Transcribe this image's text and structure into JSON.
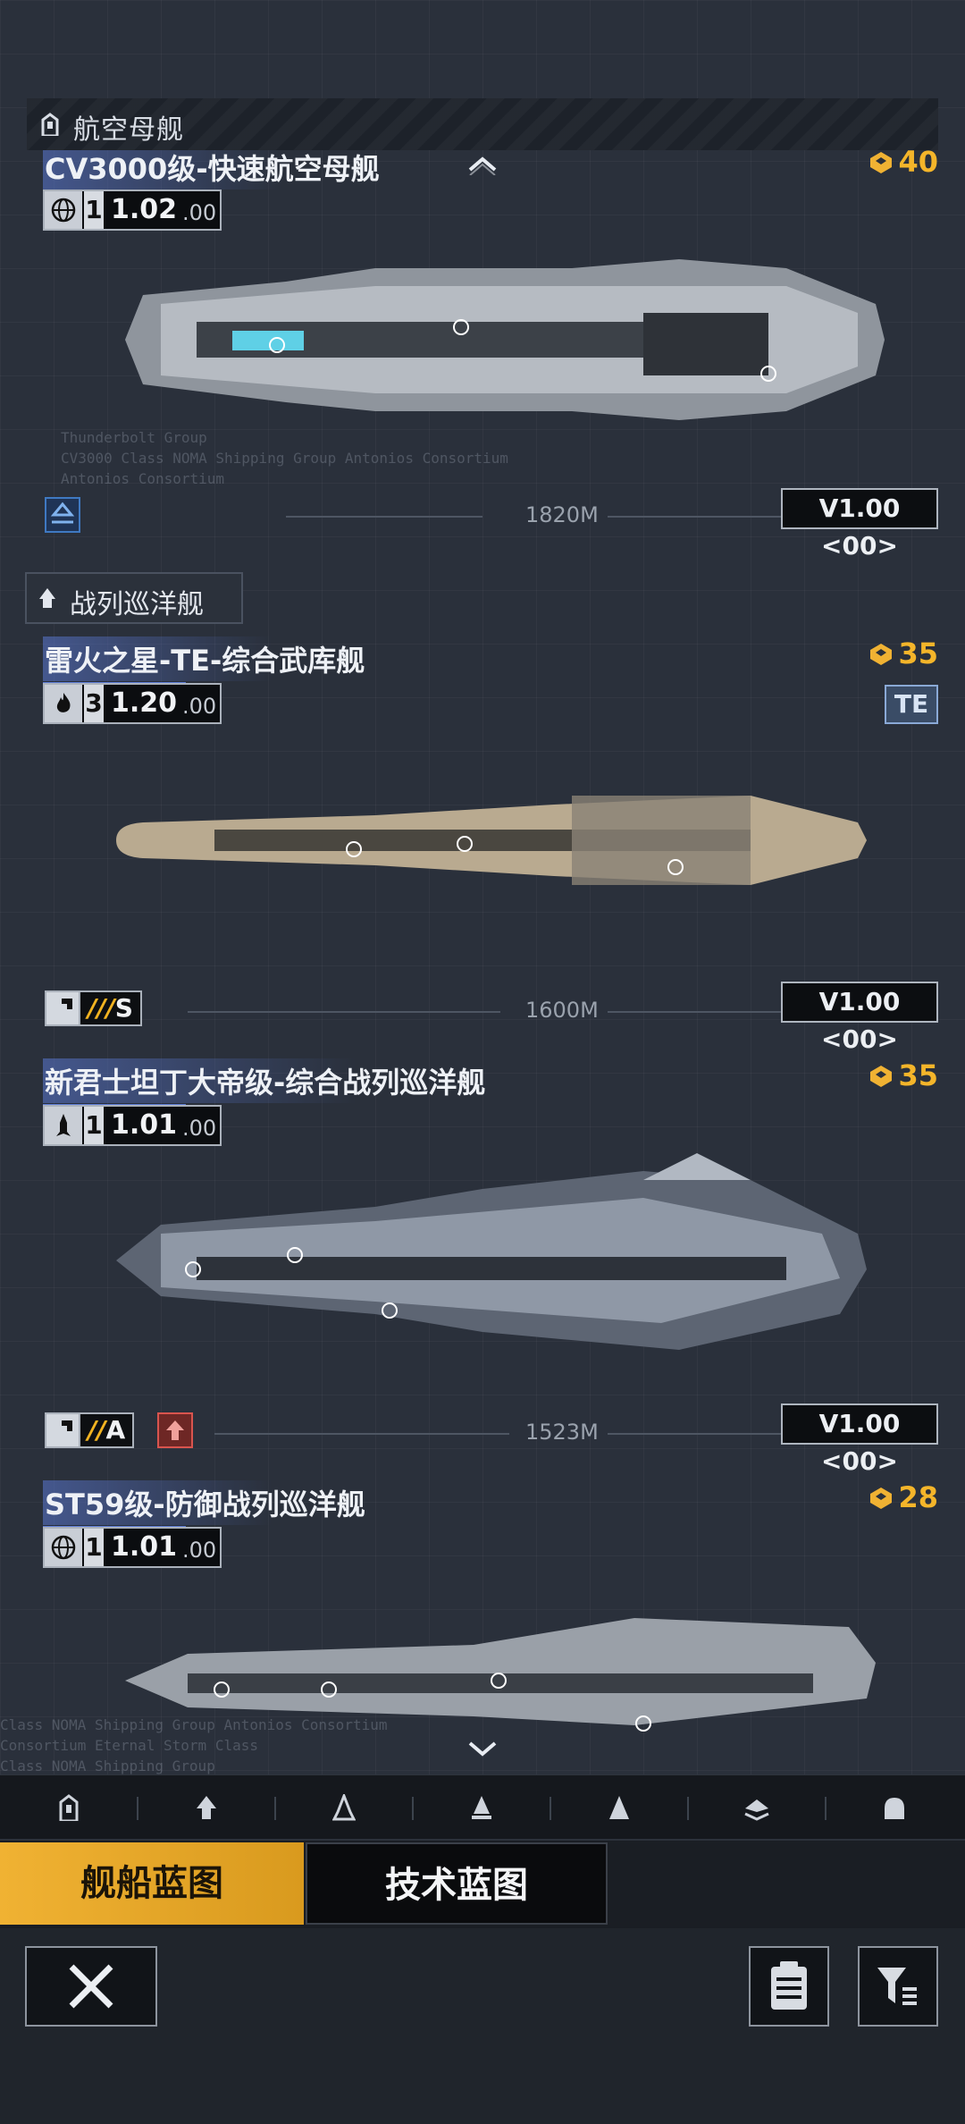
{
  "sections": {
    "carrier_header": "航空母舰",
    "battlecruiser_header": "战列巡洋舰"
  },
  "ships": [
    {
      "name": "CV3000级-快速航空母舰",
      "cost": "40",
      "level": "1",
      "value": "1.02",
      "sub": ".00",
      "version": "V1.00 <00>",
      "length": "1820M",
      "type_icon": "globe-icon",
      "bp_lines": [
        "Thunderbolt Group",
        "CV3000 Class NOMA Shipping Group Antonios Consortium",
        "Antonios Consortium"
      ]
    },
    {
      "name": "雷火之星-TE-综合武库舰",
      "cost": "35",
      "level": "3",
      "value": "1.20",
      "sub": ".00",
      "version": "V1.00 <00>",
      "length": "1600M",
      "type_icon": "flame-icon",
      "badge": "TE",
      "grade": "S",
      "grade_prefix": "///"
    },
    {
      "name": "新君士坦丁大帝级-综合战列巡洋舰",
      "cost": "35",
      "level": "1",
      "value": "1.01",
      "sub": ".00",
      "version": "V1.00 <00>",
      "length": "1523M",
      "type_icon": "rocket-icon",
      "grade": "A",
      "grade_prefix": "//"
    },
    {
      "name": "ST59级-防御战列巡洋舰",
      "cost": "28",
      "level": "1",
      "value": "1.01",
      "sub": ".00",
      "type_icon": "globe-icon",
      "bp_lines": [
        "Class NOMA Shipping Group Antonios Consortium",
        "Consortium Eternal Storm Class",
        "Class NOMA Shipping Group"
      ]
    }
  ],
  "tabs": {
    "ship_blueprint": "舰船蓝图",
    "tech_blueprint": "技术蓝图"
  },
  "nav_icons": [
    "carrier-icon",
    "battlecruiser-icon",
    "cruiser-icon",
    "destroyer-icon",
    "frigate-icon",
    "corvette-icon",
    "aircraft-icon"
  ],
  "colors": {
    "accent_gold": "#f0b233",
    "title_highlight": "#5c7bd6",
    "background": "#2a303b"
  }
}
